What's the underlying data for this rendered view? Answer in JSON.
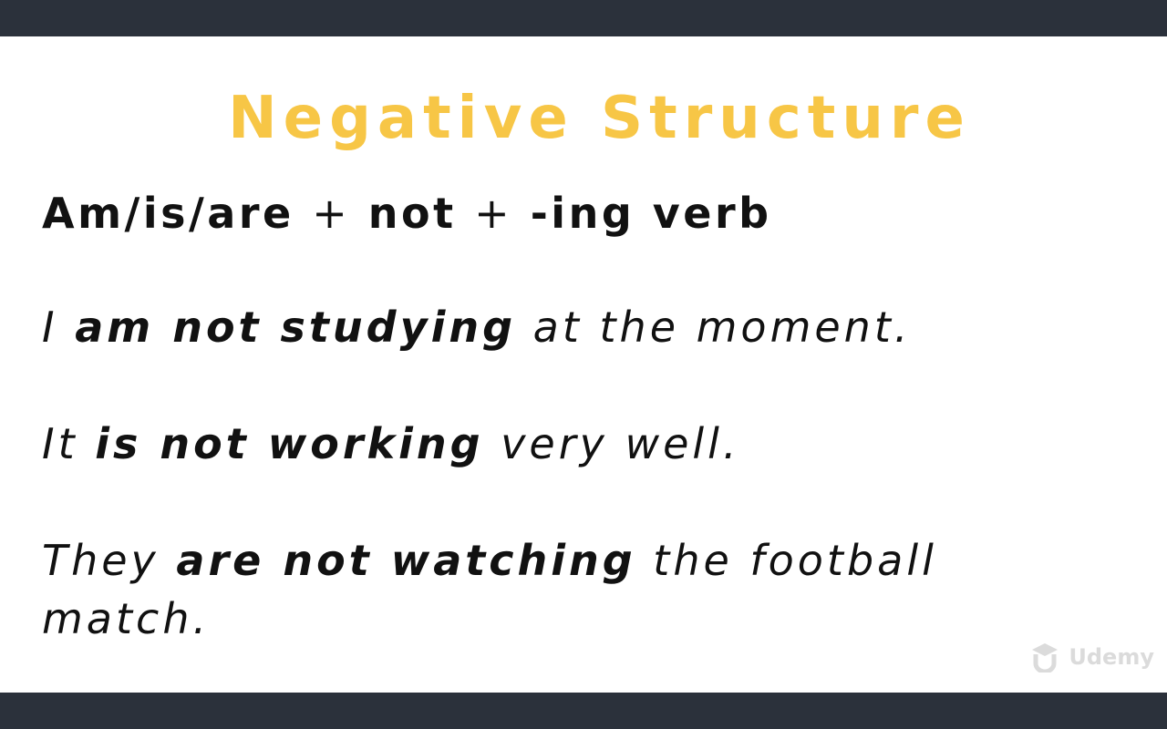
{
  "slide": {
    "title": "Negative Structure",
    "formula": {
      "subject_verb": "Am/is/are",
      "plus_1": "+",
      "negation": "not",
      "plus_2": "+",
      "verb_form": "-ing verb"
    },
    "examples": [
      {
        "before": "I ",
        "emphasis": "am not studying",
        "after": " at the moment."
      },
      {
        "before": "It ",
        "emphasis": "is not working",
        "after": " very well."
      },
      {
        "before": "They ",
        "emphasis": "are not watching",
        "after": " the football match."
      }
    ],
    "watermark": {
      "icon": "udemy-logo-icon",
      "text": "Udemy"
    }
  },
  "colors": {
    "title": "#f7c646",
    "background": "#ffffff",
    "frame": "#2b313b",
    "text": "#111111"
  }
}
